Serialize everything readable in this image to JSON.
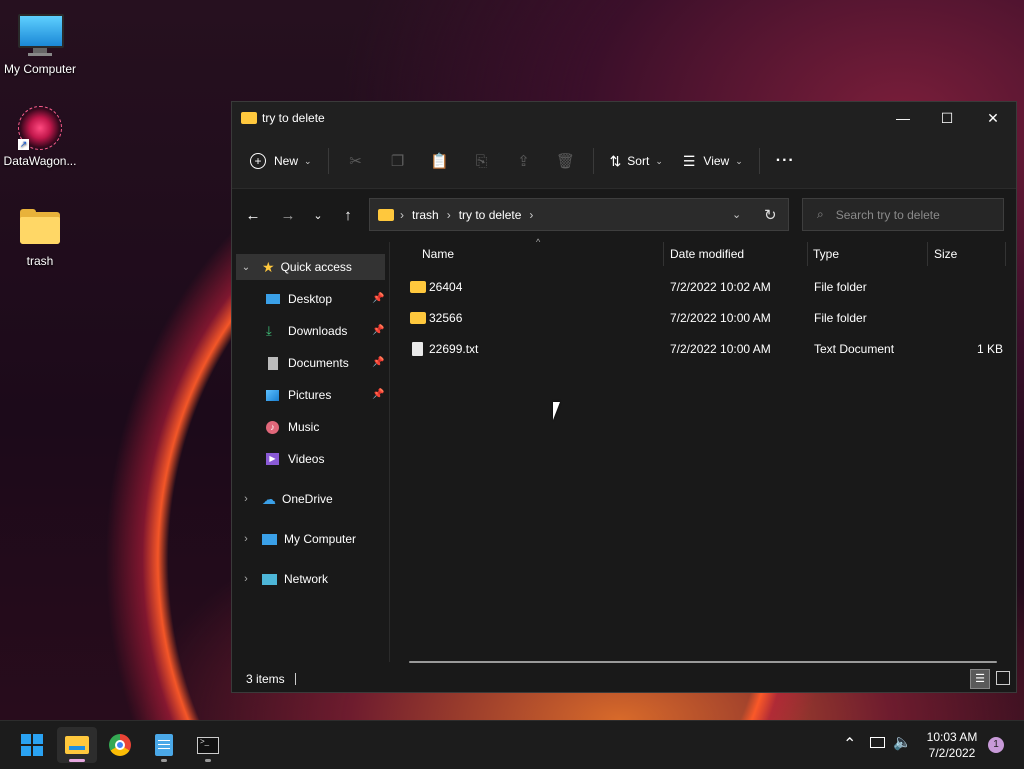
{
  "desktop": {
    "icons": [
      {
        "label": "My Computer",
        "icon": "monitor-icon"
      },
      {
        "label": "DataWagon...",
        "icon": "datawagon-icon"
      },
      {
        "label": "trash",
        "icon": "folder-icon"
      }
    ]
  },
  "window": {
    "title": "try to delete",
    "controls": {
      "minimize": "—",
      "maximize": "☐",
      "close": "✕"
    },
    "toolbar": {
      "new_label": "New",
      "sort_label": "Sort",
      "view_label": "View",
      "icons": [
        "cut-icon",
        "copy-icon",
        "paste-icon",
        "rename-icon",
        "share-icon",
        "delete-icon"
      ],
      "more_label": "···"
    },
    "address": {
      "segments": [
        "trash",
        "try to delete"
      ],
      "search_placeholder": "Search try to delete"
    },
    "nav_pane": {
      "quick_access": "Quick access",
      "items": [
        {
          "label": "Desktop",
          "pinned": true
        },
        {
          "label": "Downloads",
          "pinned": true
        },
        {
          "label": "Documents",
          "pinned": true
        },
        {
          "label": "Pictures",
          "pinned": true
        },
        {
          "label": "Music",
          "pinned": false
        },
        {
          "label": "Videos",
          "pinned": false
        }
      ],
      "roots": [
        "OneDrive",
        "My Computer",
        "Network"
      ]
    },
    "columns": {
      "name": "Name",
      "date": "Date modified",
      "type": "Type",
      "size": "Size"
    },
    "files": [
      {
        "name": "26404",
        "date": "7/2/2022 10:02 AM",
        "type": "File folder",
        "size": "",
        "kind": "folder"
      },
      {
        "name": "32566",
        "date": "7/2/2022 10:00 AM",
        "type": "File folder",
        "size": "",
        "kind": "folder"
      },
      {
        "name": "22699.txt",
        "date": "7/2/2022 10:00 AM",
        "type": "Text Document",
        "size": "1 KB",
        "kind": "file"
      }
    ],
    "status": {
      "items": "3 items"
    }
  },
  "taskbar": {
    "clock_time": "10:03 AM",
    "clock_date": "7/2/2022",
    "notification_count": "1",
    "apps": [
      "start-icon",
      "file-explorer-icon",
      "chrome-icon",
      "notepad-icon",
      "terminal-icon"
    ]
  },
  "colors": {
    "folder": "#ffc83d",
    "accent": "#0078d4",
    "window_bg": "#191919"
  }
}
